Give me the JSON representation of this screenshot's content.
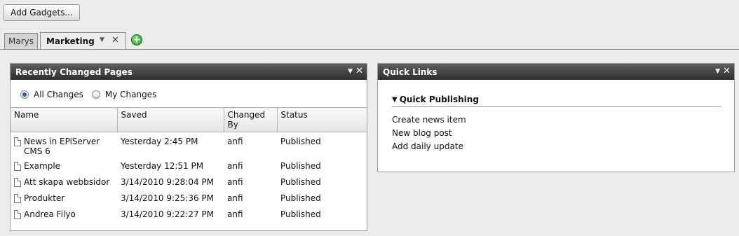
{
  "toolbar": {
    "add_gadgets_label": "Add Gadgets..."
  },
  "tabs": [
    {
      "label": "Marys"
    },
    {
      "label": "Marketing"
    }
  ],
  "recent_pages": {
    "title": "Recently Changed Pages",
    "filters": {
      "all_changes": "All Changes",
      "my_changes": "My Changes",
      "selected": "All Changes"
    },
    "columns": [
      "Name",
      "Saved",
      "Changed By",
      "Status"
    ],
    "rows": [
      {
        "name": "News in EPiServer CMS 6",
        "saved": "Yesterday 2:45 PM",
        "changed_by": "anfi",
        "status": "Published"
      },
      {
        "name": "Example",
        "saved": "Yesterday 12:51 PM",
        "changed_by": "anfi",
        "status": "Published"
      },
      {
        "name": "Att skapa webbsidor",
        "saved": "3/14/2010 9:28:04 PM",
        "changed_by": "anfi",
        "status": "Published"
      },
      {
        "name": "Produkter",
        "saved": "3/14/2010 9:25:36 PM",
        "changed_by": "anfi",
        "status": "Published"
      },
      {
        "name": "Andrea Filyo",
        "saved": "3/14/2010 9:22:27 PM",
        "changed_by": "anfi",
        "status": "Published"
      }
    ]
  },
  "quick_links": {
    "title": "Quick Links",
    "section_title": "Quick Publishing",
    "links": [
      "Create news item",
      "New blog post",
      "Add daily update"
    ]
  }
}
